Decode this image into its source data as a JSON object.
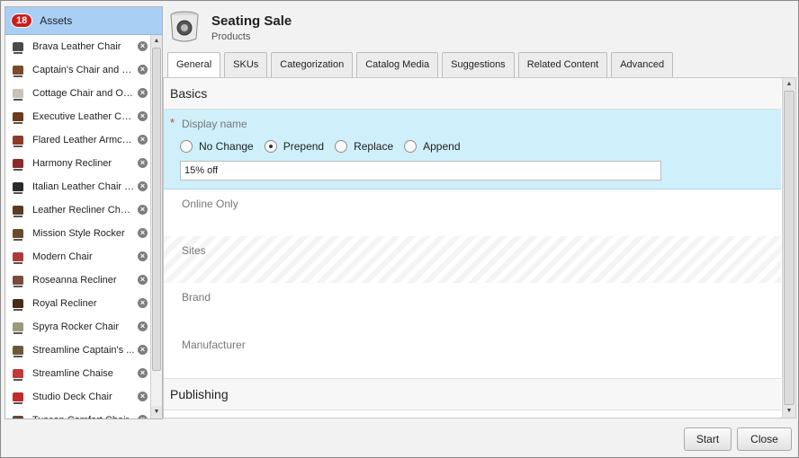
{
  "assets": {
    "count": "18",
    "header_label": "Assets",
    "items": [
      {
        "name": "Brava Leather Chair",
        "color": "#4a4a4a"
      },
      {
        "name": "Captain's Chair and O...",
        "color": "#7a4a2a"
      },
      {
        "name": "Cottage Chair and Ott...",
        "color": "#c9c2b5"
      },
      {
        "name": "Executive Leather Ch...",
        "color": "#6b3a1f"
      },
      {
        "name": "Flared Leather Armch...",
        "color": "#8b3a2a"
      },
      {
        "name": "Harmony Recliner",
        "color": "#8a2a2a"
      },
      {
        "name": "Italian Leather Chair a...",
        "color": "#2a2a2a"
      },
      {
        "name": "Leather Recliner Chai...",
        "color": "#5a3a22"
      },
      {
        "name": "Mission Style Rocker",
        "color": "#6a4a2a"
      },
      {
        "name": "Modern Chair",
        "color": "#b03a3a"
      },
      {
        "name": "Roseanna Recliner",
        "color": "#7a4a3a"
      },
      {
        "name": "Royal Recliner",
        "color": "#4a2a1a"
      },
      {
        "name": "Spyra Rocker Chair",
        "color": "#9a9a7a"
      },
      {
        "name": "Streamline Captain's ...",
        "color": "#6a5a3a"
      },
      {
        "name": "Streamline Chaise",
        "color": "#c03a3a"
      },
      {
        "name": "Studio Deck Chair",
        "color": "#c02a2a"
      },
      {
        "name": "Tuscan Comfort Chair",
        "color": "#5a4a3a"
      }
    ]
  },
  "header": {
    "title": "Seating Sale",
    "subtitle": "Products"
  },
  "tabs": [
    {
      "label": "General",
      "active": true
    },
    {
      "label": "SKUs"
    },
    {
      "label": "Categorization"
    },
    {
      "label": "Catalog Media"
    },
    {
      "label": "Suggestions"
    },
    {
      "label": "Related Content"
    },
    {
      "label": "Advanced"
    }
  ],
  "form": {
    "basics_heading": "Basics",
    "required_mark": "*",
    "display_name_label": "Display name",
    "radio_options": [
      {
        "label": "No Change",
        "selected": false
      },
      {
        "label": "Prepend",
        "selected": true
      },
      {
        "label": "Replace",
        "selected": false
      },
      {
        "label": "Append",
        "selected": false
      }
    ],
    "display_name_value": "15% off",
    "online_only_label": "Online Only",
    "sites_label": "Sites",
    "brand_label": "Brand",
    "manufacturer_label": "Manufacturer",
    "publishing_heading": "Publishing"
  },
  "footer": {
    "start_label": "Start",
    "close_label": "Close"
  },
  "icons": {
    "remove": "x-circle-icon",
    "jar": "product-jar-icon"
  }
}
